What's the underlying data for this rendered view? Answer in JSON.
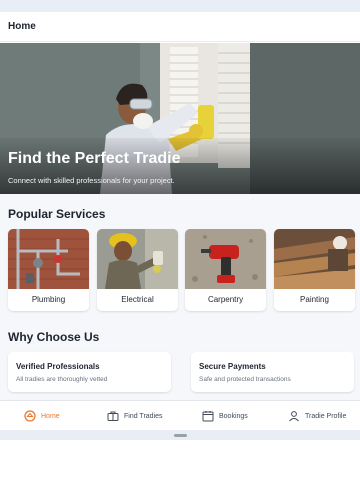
{
  "header": {
    "title": "Home"
  },
  "hero": {
    "title": "Find the Perfect Tradie",
    "subtitle": "Connect with skilled professionals for your project."
  },
  "popular": {
    "title": "Popular Services",
    "services": [
      {
        "label": "Plumbing",
        "image": "plumbing-photo"
      },
      {
        "label": "Electrical",
        "image": "electrician-photo"
      },
      {
        "label": "Carpentry",
        "image": "drill-photo"
      },
      {
        "label": "Painting",
        "image": "wood-workshop-photo"
      }
    ]
  },
  "why": {
    "title": "Why Choose Us",
    "cards": [
      {
        "title": "Verified Professionals",
        "desc": "All tradies are thoroughly vetted"
      },
      {
        "title": "Secure Payments",
        "desc": "Safe and protected transactions"
      }
    ]
  },
  "nav": {
    "items": [
      {
        "label": "Home",
        "icon": "home-icon",
        "active": true
      },
      {
        "label": "Find Tradies",
        "icon": "briefcase-icon",
        "active": false
      },
      {
        "label": "Bookings",
        "icon": "calendar-icon",
        "active": false
      },
      {
        "label": "Tradie Profile",
        "icon": "person-icon",
        "active": false
      }
    ]
  },
  "colors": {
    "accent": "#e8782b",
    "background": "#f5f7fa",
    "text": "#1e2430",
    "muted": "#6a7280"
  }
}
